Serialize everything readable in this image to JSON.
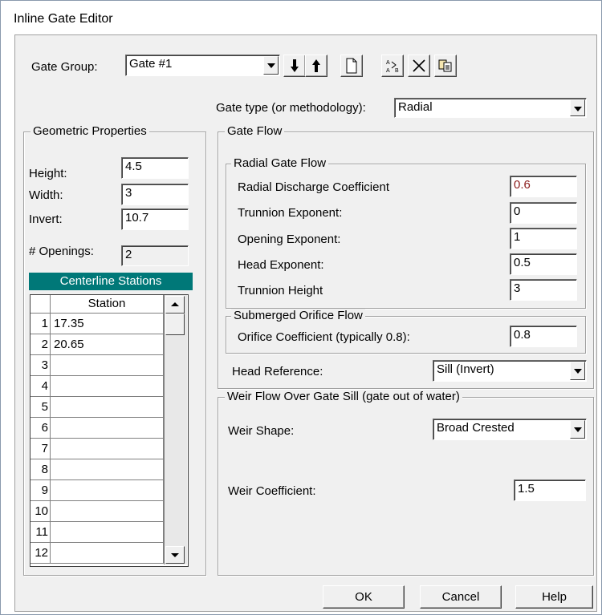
{
  "window": {
    "title": "Inline Gate Editor"
  },
  "gate_group": {
    "label": "Gate Group:",
    "value": "Gate #1"
  },
  "toolbar": {
    "move_down": "arrow-down-icon",
    "move_up": "arrow-up-icon",
    "add": "new-document-icon",
    "rename": "rename-icon",
    "delete": "delete-x-icon",
    "copy": "copy-icon"
  },
  "gate_type": {
    "label": "Gate type (or methodology):",
    "value": "Radial"
  },
  "geometric": {
    "title": "Geometric Properties",
    "height_label": "Height:",
    "height": "4.5",
    "width_label": "Width:",
    "width": "3",
    "invert_label": "Invert:",
    "invert": "10.7",
    "openings_label": "# Openings:",
    "openings": "2"
  },
  "centerline": {
    "header": "Centerline Stations",
    "column": "Station",
    "rows": [
      {
        "n": "1",
        "v": "17.35"
      },
      {
        "n": "2",
        "v": "20.65"
      },
      {
        "n": "3",
        "v": ""
      },
      {
        "n": "4",
        "v": ""
      },
      {
        "n": "5",
        "v": ""
      },
      {
        "n": "6",
        "v": ""
      },
      {
        "n": "7",
        "v": ""
      },
      {
        "n": "8",
        "v": ""
      },
      {
        "n": "9",
        "v": ""
      },
      {
        "n": "10",
        "v": ""
      },
      {
        "n": "11",
        "v": ""
      },
      {
        "n": "12",
        "v": ""
      }
    ]
  },
  "gate_flow": {
    "title": "Gate Flow",
    "radial": {
      "title": "Radial Gate Flow",
      "coef_label": "Radial Discharge Coefficient",
      "coef": "0.6",
      "coef_color": "#8b1a1a",
      "trunnion_exp_label": "Trunnion Exponent:",
      "trunnion_exp": "0",
      "opening_exp_label": "Opening Exponent:",
      "opening_exp": "1",
      "head_exp_label": "Head Exponent:",
      "head_exp": "0.5",
      "trunnion_h_label": "Trunnion Height",
      "trunnion_h": "3"
    },
    "orifice": {
      "title": "Submerged Orifice Flow",
      "coef_label": "Orifice Coefficient (typically 0.8):",
      "coef": "0.8"
    },
    "head_ref_label": "Head Reference:",
    "head_ref": "Sill (Invert)"
  },
  "weir": {
    "title": "Weir Flow Over Gate Sill (gate out of water)",
    "shape_label": "Weir Shape:",
    "shape": "Broad Crested",
    "coef_label": "Weir Coefficient:",
    "coef": "1.5"
  },
  "buttons": {
    "ok": "OK",
    "cancel": "Cancel",
    "help": "Help"
  }
}
